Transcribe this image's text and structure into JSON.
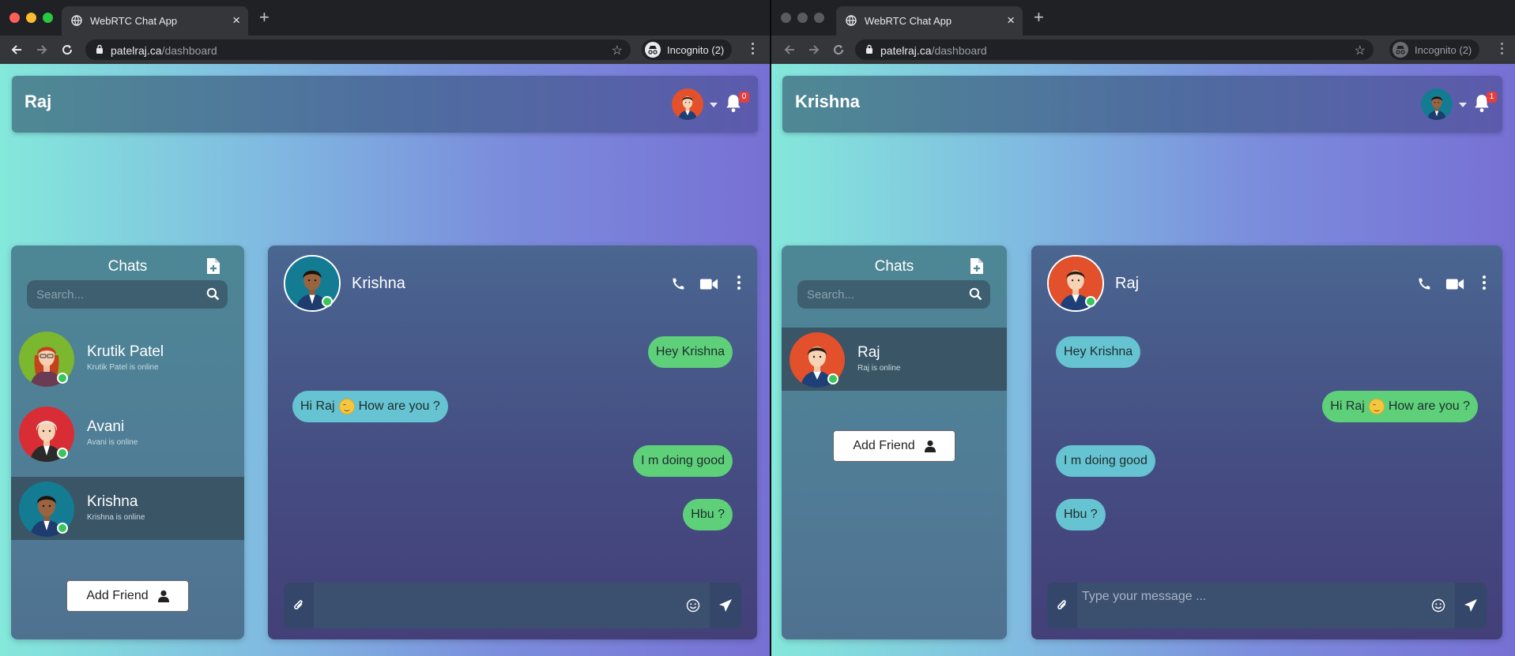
{
  "colors": {
    "bubble_sent": "#5fd07a",
    "bubble_received": "#66c3d1",
    "online": "#38c55a",
    "badge": "#e53e3e"
  },
  "left": {
    "tab_title": "WebRTC Chat App",
    "url_host": "patelraj.ca",
    "url_path": "/dashboard",
    "incognito": "Incognito (2)",
    "header_name": "Raj",
    "notification_count": "0",
    "sidebar": {
      "title": "Chats",
      "search_placeholder": "Search...",
      "contacts": [
        {
          "name": "Krutik Patel",
          "status": "Krutik Patel is online"
        },
        {
          "name": "Avani",
          "status": "Avani is online"
        },
        {
          "name": "Krishna",
          "status": "Krishna is online"
        }
      ],
      "add_friend": "Add Friend"
    },
    "chat": {
      "name": "Krishna",
      "messages": [
        {
          "text": "Hey Krishna",
          "side": "sent"
        },
        {
          "text_before": "Hi Raj",
          "text_after": "How are you ?",
          "side": "received"
        },
        {
          "text": "I m doing good",
          "side": "sent"
        },
        {
          "text": "Hbu ?",
          "side": "sent"
        }
      ],
      "input_placeholder": ""
    }
  },
  "right": {
    "tab_title": "WebRTC Chat App",
    "url_host": "patelraj.ca",
    "url_path": "/dashboard",
    "incognito": "Incognito (2)",
    "header_name": "Krishna",
    "notification_count": "1",
    "sidebar": {
      "title": "Chats",
      "search_placeholder": "Search...",
      "contacts": [
        {
          "name": "Raj",
          "status": "Raj is online"
        }
      ],
      "add_friend": "Add Friend"
    },
    "chat": {
      "name": "Raj",
      "messages": [
        {
          "text": "Hey Krishna",
          "side": "received"
        },
        {
          "text_before": "Hi Raj",
          "text_after": "How are you ?",
          "side": "sent"
        },
        {
          "text": "I m doing good",
          "side": "received"
        },
        {
          "text": "Hbu ?",
          "side": "received"
        }
      ],
      "input_placeholder": "Type your message ..."
    }
  }
}
